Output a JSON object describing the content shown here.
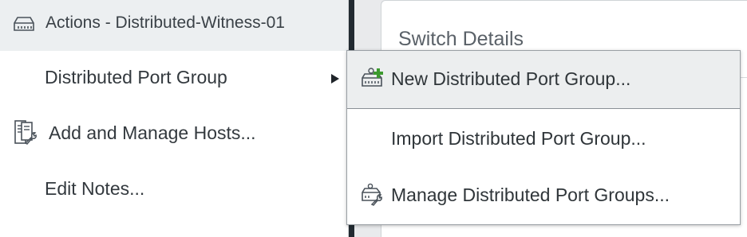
{
  "actions_menu": {
    "header": {
      "icon": "distributed-switch-icon",
      "title": "Actions - Distributed-Witness-01"
    },
    "items": [
      {
        "label": "Distributed Port Group",
        "icon": "",
        "has_submenu": true
      },
      {
        "label": "Add and Manage Hosts...",
        "icon": "hosts-wrench-icon",
        "has_submenu": false
      },
      {
        "label": "Edit Notes...",
        "icon": "",
        "has_submenu": false
      }
    ]
  },
  "submenu": {
    "items": [
      {
        "label": "New Distributed Port Group...",
        "icon": "new-port-group-icon"
      },
      {
        "label": "Import Distributed Port Group...",
        "icon": ""
      },
      {
        "label": "Manage Distributed Port Groups...",
        "icon": "manage-port-groups-icon"
      }
    ]
  },
  "background_card": {
    "title": "Switch Details"
  },
  "colors": {
    "header_bg": "#eceff1",
    "active_submenu_bg": "#eceeef",
    "add_icon_green": "#3c9a2f",
    "dark_strip": "#222a31"
  }
}
